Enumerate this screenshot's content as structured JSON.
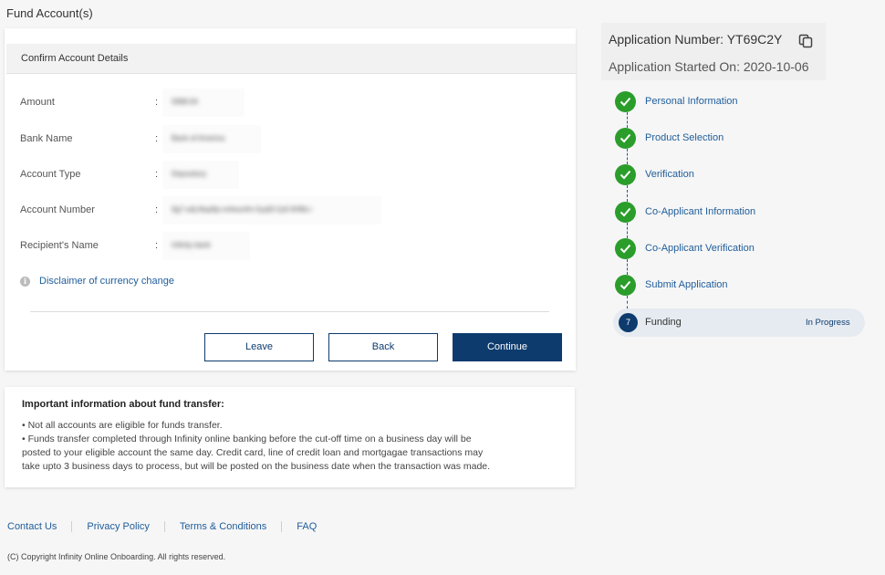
{
  "page": {
    "title": "Fund Account(s)"
  },
  "details": {
    "header": "Confirm Account Details",
    "colon": ":",
    "rows": [
      {
        "label": "Amount",
        "value": "5998.00"
      },
      {
        "label": "Bank Name",
        "value": "Bank of America"
      },
      {
        "label": "Account Type",
        "value": "Depository"
      },
      {
        "label": "Account Number",
        "value": "9g7-a4j-8wp9p-m4wunfm-5yq5f-2y6-9rf6b-i"
      },
      {
        "label": "Recipient's Name",
        "value": "Infinity bank"
      }
    ],
    "disclaimer": "Disclaimer of currency change",
    "buttons": {
      "leave": "Leave",
      "back": "Back",
      "continue": "Continue"
    }
  },
  "info": {
    "title": "Important information about fund transfer:",
    "lines": [
      "• Not all accounts are eligible for funds transfer.",
      "• Funds transfer completed through Infinity online banking before the cut-off time on a business day will be",
      "posted to your eligible account the same day. Credit card, line of credit loan and mortgagae transactions may",
      "take upto 3 business days to process, but will be posted on the business date when the transaction was made."
    ]
  },
  "footer": {
    "links": [
      "Contact Us",
      "Privacy Policy",
      "Terms & Conditions",
      "FAQ"
    ],
    "copyright": "(C) Copyright Infinity Online Onboarding. All rights reserved."
  },
  "application": {
    "number_label": "Application Number: YT69C2Y",
    "started_label": "Application Started On: 2020-10-06"
  },
  "steps": {
    "completed": [
      "Personal Information",
      "Product Selection",
      "Verification",
      "Co-Applicant Information",
      "Co-Applicant Verification",
      "Submit Application"
    ],
    "current": {
      "number": "7",
      "label": "Funding",
      "status": "In Progress"
    }
  },
  "colors": {
    "primary": "#0d3b6e",
    "link": "#1f5d9a",
    "success": "#2a9d2a",
    "page_bg": "#f6f6f6"
  }
}
